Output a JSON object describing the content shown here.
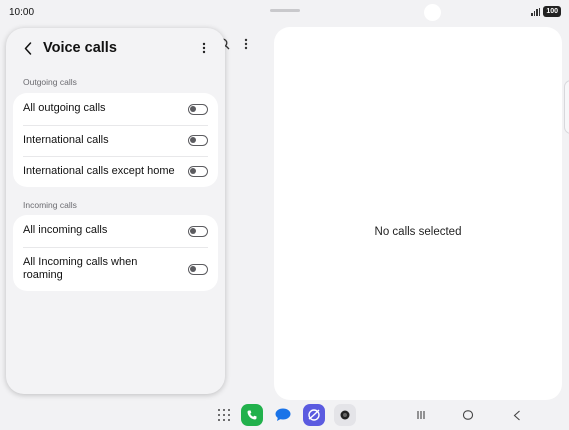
{
  "status_bar": {
    "time": "10:00",
    "battery": "100"
  },
  "popup": {
    "title": "Voice calls",
    "sections": [
      {
        "label": "Outgoing calls",
        "items": [
          {
            "label": "All outgoing calls",
            "enabled": false
          },
          {
            "label": "International calls",
            "enabled": false
          },
          {
            "label": "International calls except home",
            "enabled": false
          }
        ]
      },
      {
        "label": "Incoming calls",
        "items": [
          {
            "label": "All incoming calls",
            "enabled": false
          },
          {
            "label": "All Incoming calls when roaming",
            "enabled": false
          }
        ]
      }
    ]
  },
  "detail_pane": {
    "empty_message": "No calls selected"
  },
  "dock": {
    "apps": [
      {
        "icon": "phone-app-icon",
        "color": "#22b14c"
      },
      {
        "icon": "messages-app-icon",
        "color": "#1a73e8"
      },
      {
        "icon": "internet-app-icon",
        "color": "#5b5be0"
      },
      {
        "icon": "camera-app-icon",
        "color": "#e4e4e8"
      }
    ]
  },
  "colors": {
    "background": "#f2f2f4",
    "card": "#ffffff",
    "toggle_off": "#5c5c60"
  }
}
